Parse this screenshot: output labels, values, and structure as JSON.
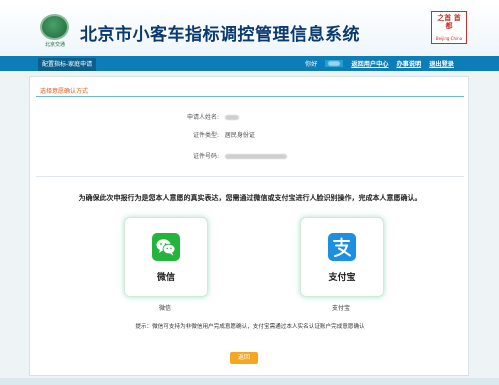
{
  "header": {
    "logo_text": "北京交通",
    "title": "北京市小客车指标调控管理信息系统",
    "seal_text": "之首 首都",
    "seal_sub": "Beijing·China"
  },
  "navbar": {
    "active_tab": "配置指标-家庭申请",
    "greeting": "你好",
    "user": "",
    "links": [
      "返回用户中心",
      "办事说明",
      "退出登录"
    ]
  },
  "form": {
    "section_title": "选择意愿确认方式",
    "rows": [
      {
        "label": "申请人姓名:",
        "value": ""
      },
      {
        "label": "证件类型:",
        "value": "居民身份证"
      },
      {
        "label": "证件号码:",
        "value": ""
      }
    ]
  },
  "notice": "为确保此次申报行为是您本人意愿的真实表达，您需通过微信或支付宝进行人脸识别操作，完成本人意愿确认。",
  "options": [
    {
      "icon": "wechat-icon",
      "label": "微信",
      "caption": "微信"
    },
    {
      "icon": "alipay-icon",
      "label": "支付宝",
      "caption": "支付宝"
    }
  ],
  "tip": "提示：微信可支持为非微信用户完成意愿确认，支付宝需通过本人实名认证账户完成意愿确认",
  "back_button": "返回",
  "colors": {
    "nav": "#0c7db6",
    "accent_orange": "#f5a623",
    "wechat": "#24b33c",
    "alipay": "#1d8fe0",
    "title": "#0b3a6e"
  }
}
